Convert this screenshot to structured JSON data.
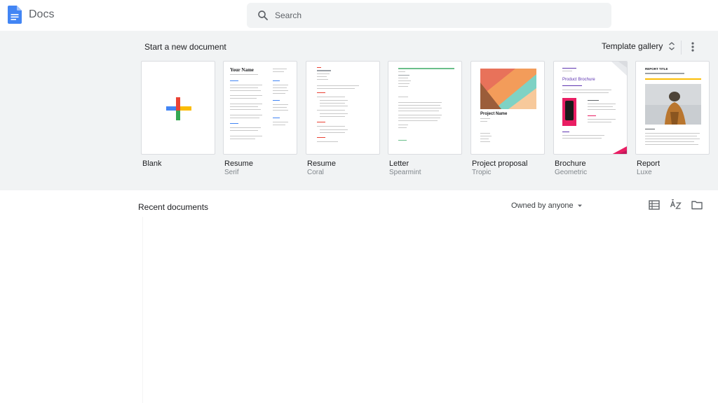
{
  "header": {
    "app_name": "Docs",
    "search_placeholder": "Search"
  },
  "templates_section": {
    "title": "Start a new document",
    "gallery_label": "Template gallery"
  },
  "templates": [
    {
      "name": "Blank",
      "sub": ""
    },
    {
      "name": "Resume",
      "sub": "Serif",
      "thumb_title": "Your Name"
    },
    {
      "name": "Resume",
      "sub": "Coral"
    },
    {
      "name": "Letter",
      "sub": "Spearmint"
    },
    {
      "name": "Project proposal",
      "sub": "Tropic",
      "thumb_title": "Project Name"
    },
    {
      "name": "Brochure",
      "sub": "Geometric",
      "thumb_title": "Product Brochure"
    },
    {
      "name": "Report",
      "sub": "Luxe",
      "thumb_title": "REPORT TITLE"
    }
  ],
  "recent": {
    "title": "Recent documents",
    "owner_filter": "Owned by anyone"
  },
  "icons": [
    "docs-logo-icon",
    "search-icon",
    "unfold-icon",
    "more-vert-icon",
    "list-view-icon",
    "sort-az-icon",
    "folder-icon"
  ],
  "colors": {
    "docs_blue": "#4285f4",
    "band_bg": "#f1f3f4",
    "plus_red": "#ea4335",
    "plus_blue": "#4285f4",
    "plus_green": "#34a853",
    "plus_yellow": "#fbbc04"
  }
}
